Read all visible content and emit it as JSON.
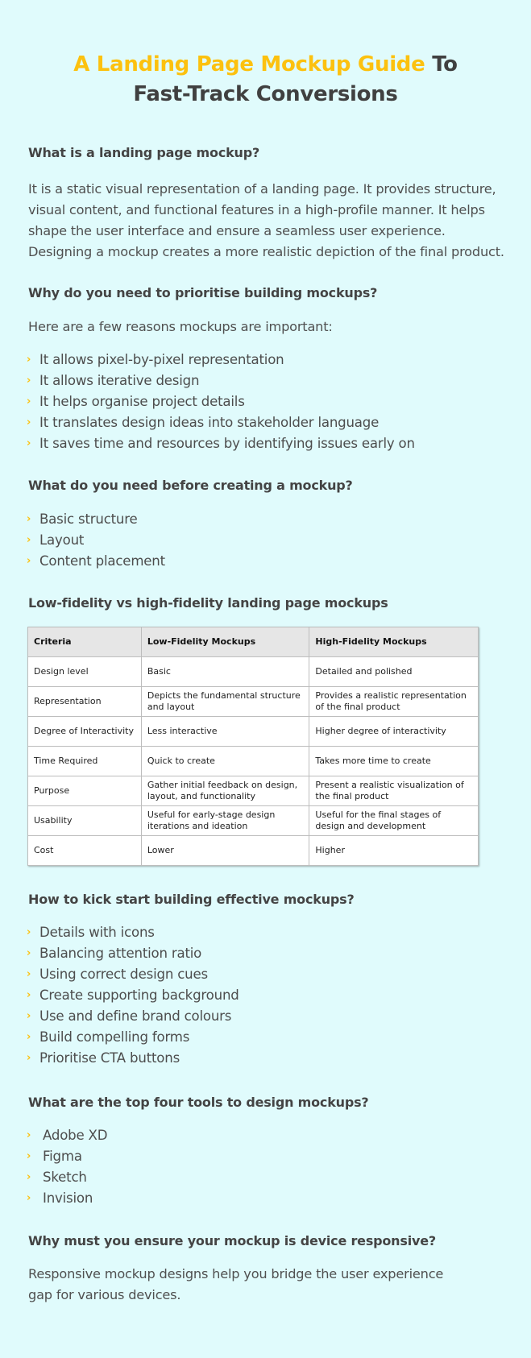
{
  "colors": {
    "accent": "#fcc10f",
    "background": "#e0fbfc",
    "text": "#444444"
  },
  "title": {
    "accent_part": "A Landing Page Mockup Guide",
    "rest_part_line1": " To",
    "line2": "Fast-Track Conversions"
  },
  "sections": {
    "what_is": {
      "heading": "What is a landing page mockup?",
      "body": "It is a static visual representation of a landing page. It provides structure, visual content, and functional features in a high-profile manner. It helps shape the user interface and ensure a seamless user experience. Designing a mockup creates a more realistic depiction of the final product."
    },
    "why_prioritise": {
      "heading": "Why do you need to prioritise building mockups?",
      "intro": "Here are a few reasons mockups are important:",
      "items": [
        "It allows pixel-by-pixel representation",
        "It allows iterative design",
        "It helps organise project details",
        "It translates design ideas into stakeholder language",
        "It saves time and resources by identifying issues early on"
      ]
    },
    "before_creating": {
      "heading": "What do you need before creating a mockup?",
      "items": [
        "Basic structure",
        "Layout",
        "Content placement"
      ]
    },
    "comparison": {
      "heading": "Low-fidelity vs high-fidelity landing page mockups",
      "columns": [
        "Criteria",
        "Low-Fidelity Mockups",
        "High-Fidelity Mockups"
      ],
      "rows": [
        [
          "Design level",
          "Basic",
          "Detailed and polished"
        ],
        [
          "Representation",
          "Depicts the fundamental structure and layout",
          "Provides a realistic representation of the final product"
        ],
        [
          "Degree of Interactivity",
          "Less interactive",
          "Higher degree of interactivity"
        ],
        [
          "Time Required",
          "Quick to create",
          "Takes more time to create"
        ],
        [
          "Purpose",
          "Gather initial feedback on design, layout, and functionality",
          "Present a realistic visualization of the final product"
        ],
        [
          "Usability",
          "Useful for early-stage design iterations and ideation",
          "Useful for the final stages of design and development"
        ],
        [
          "Cost",
          "Lower",
          "Higher"
        ]
      ]
    },
    "kick_start": {
      "heading": "How to kick start building effective mockups?",
      "items": [
        "Details with icons",
        "Balancing attention ratio",
        "Using correct design cues",
        "Create supporting background",
        "Use and define brand colours",
        "Build compelling forms",
        "Prioritise CTA buttons"
      ]
    },
    "tools": {
      "heading": "What are the top four tools to design mockups?",
      "items": [
        "Adobe XD",
        "Figma",
        "Sketch",
        "Invision"
      ]
    },
    "responsive": {
      "heading": "Why must you ensure your mockup is device responsive?",
      "body_line1": "Responsive mockup designs help you bridge the user experience",
      "body_line2": "gap for various devices."
    }
  },
  "icons": {
    "bullet": "chevron-right-icon",
    "bullet_glyph": "›"
  }
}
